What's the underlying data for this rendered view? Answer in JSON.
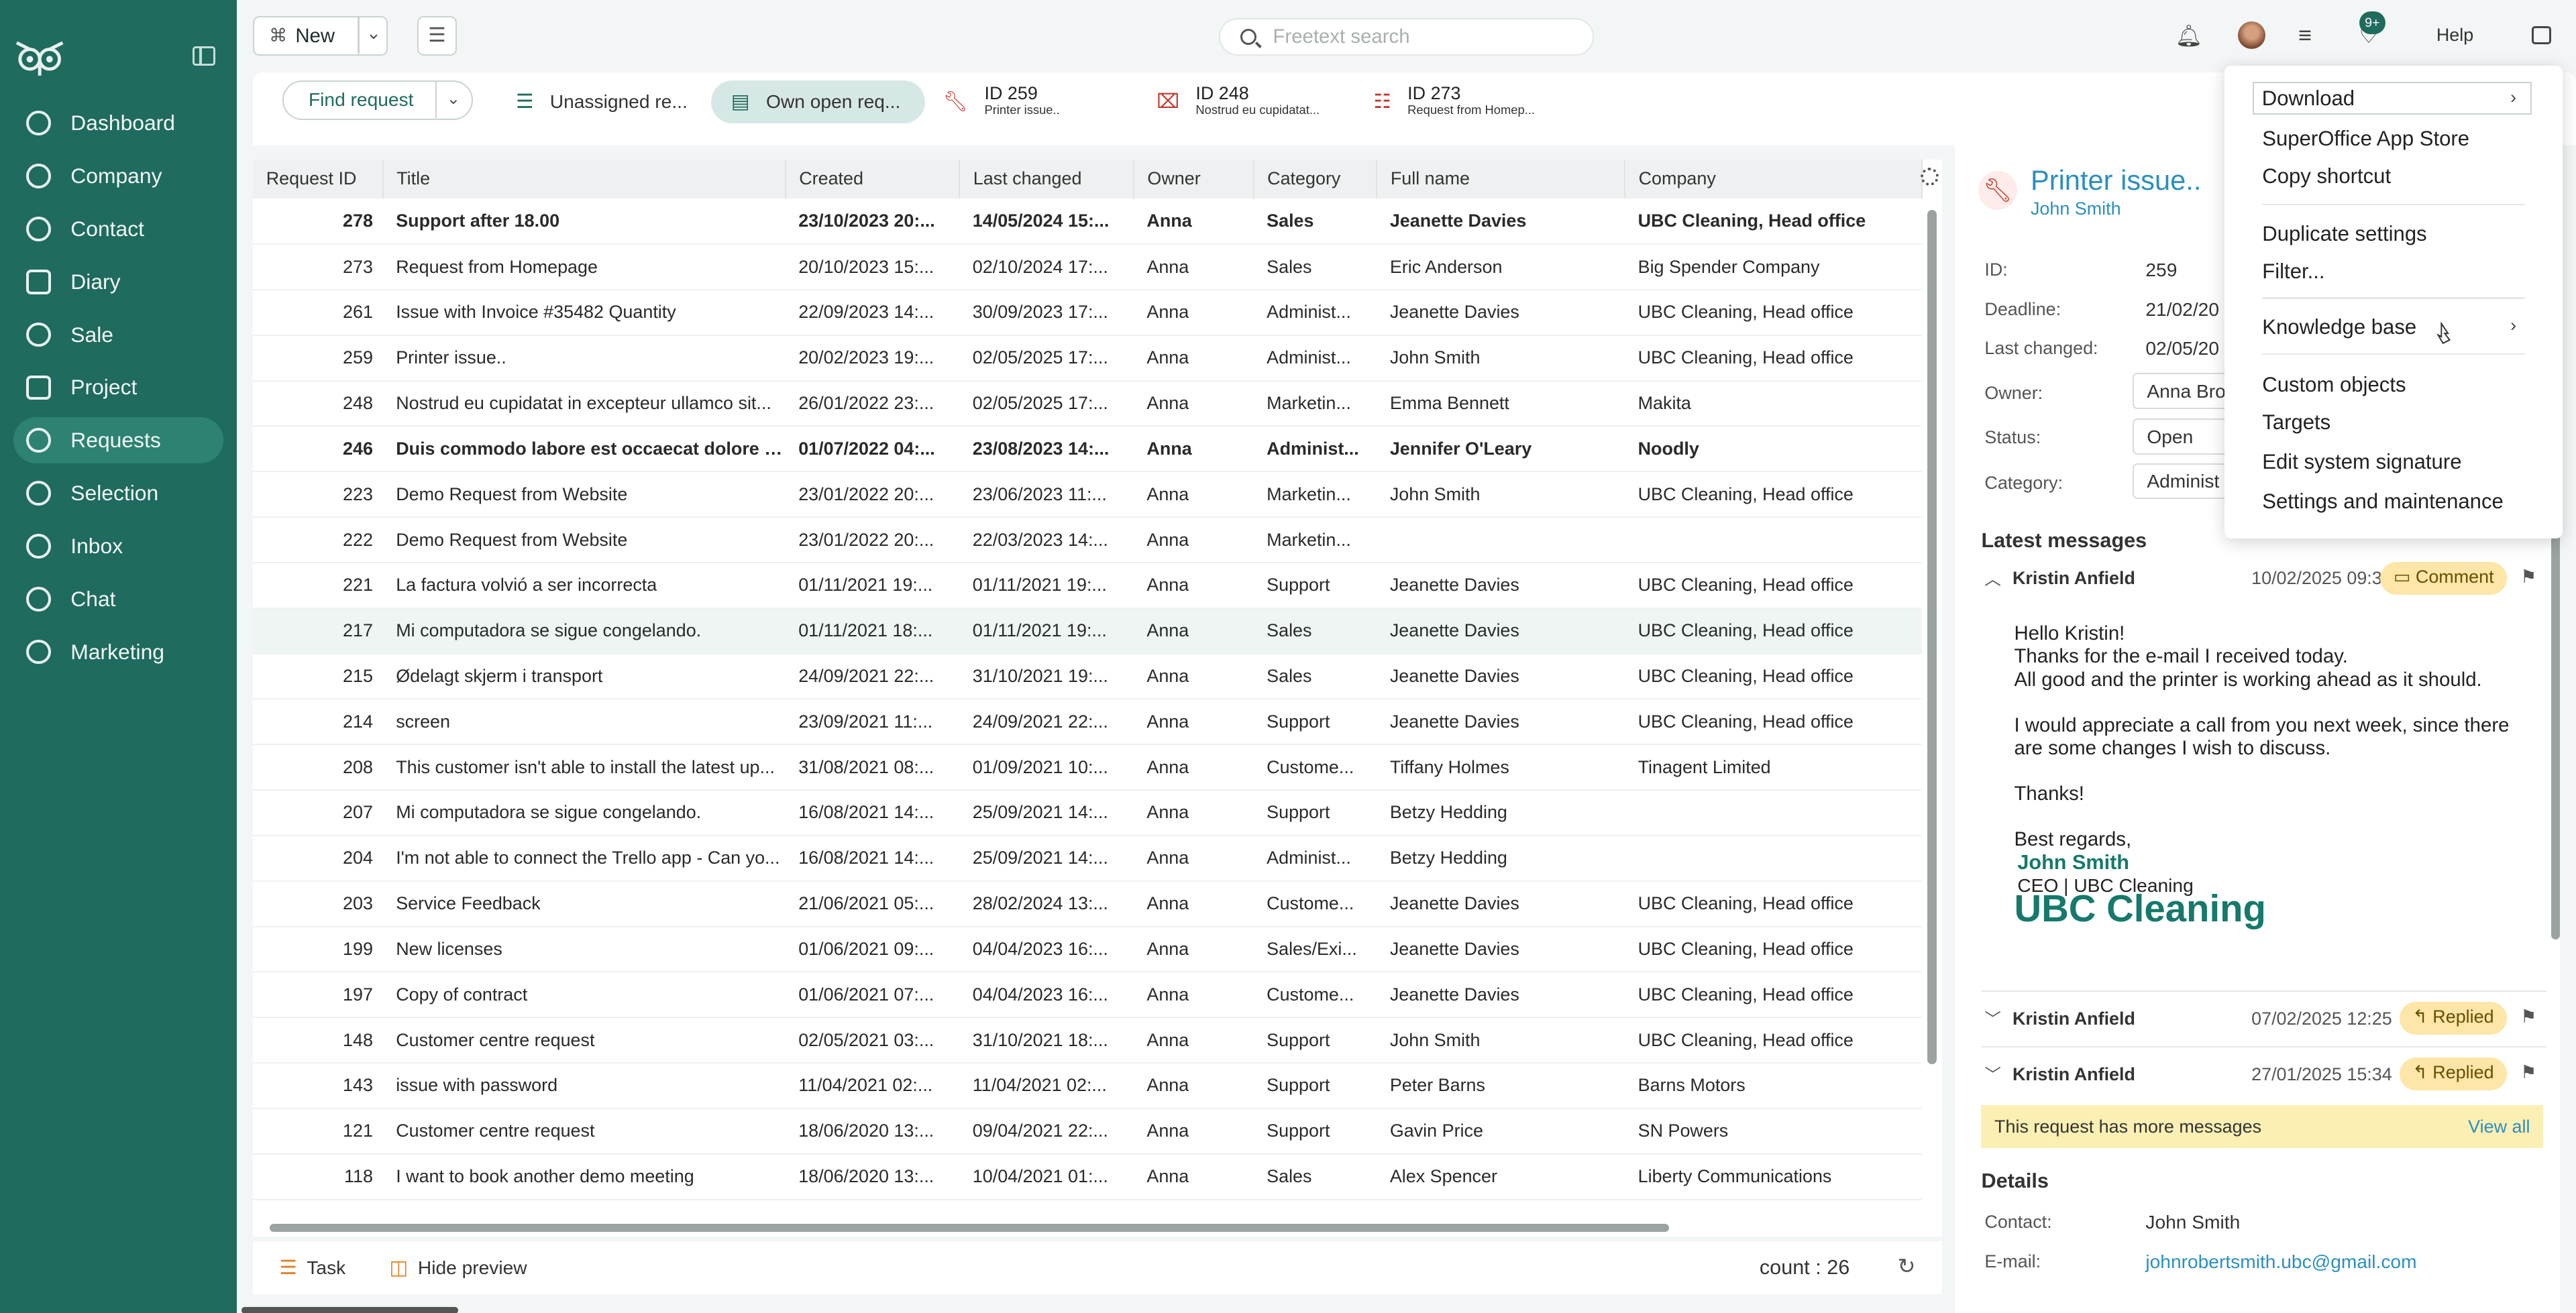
{
  "sidebar": {
    "items": [
      {
        "label": "Dashboard",
        "icon": "dashboard-icon"
      },
      {
        "label": "Company",
        "icon": "building-icon"
      },
      {
        "label": "Contact",
        "icon": "contact-icon"
      },
      {
        "label": "Diary",
        "icon": "calendar-icon"
      },
      {
        "label": "Sale",
        "icon": "dollar-icon"
      },
      {
        "label": "Project",
        "icon": "clipboard-icon"
      },
      {
        "label": "Requests",
        "icon": "ticket-icon",
        "active": true
      },
      {
        "label": "Selection",
        "icon": "target-icon"
      },
      {
        "label": "Inbox",
        "icon": "at-icon"
      },
      {
        "label": "Chat",
        "icon": "chat-icon"
      },
      {
        "label": "Marketing",
        "icon": "megaphone-icon"
      }
    ]
  },
  "topbar": {
    "new_label": "New",
    "search_placeholder": "Freetext search",
    "badge": "9+",
    "help": "Help"
  },
  "tabs": {
    "find_label": "Find request",
    "unassigned": "Unassigned re...",
    "own_open": "Own open req...",
    "open_items": [
      {
        "id": "ID 259",
        "sub": "Printer issue.."
      },
      {
        "id": "ID 248",
        "sub": "Nostrud eu cupidatat..."
      },
      {
        "id": "ID 273",
        "sub": "Request from Homep..."
      }
    ]
  },
  "table": {
    "headers": [
      "Request ID",
      "Title",
      "Created",
      "Last changed",
      "Owner",
      "Category",
      "Full name",
      "Company"
    ],
    "rows": [
      [
        "278",
        "Support after 18.00",
        "23/10/2023 20:...",
        "14/05/2024 15:...",
        "Anna",
        "Sales",
        "Jeanette Davies",
        "UBC Cleaning, Head office"
      ],
      [
        "273",
        "Request from Homepage",
        "20/10/2023 15:...",
        "02/10/2024 17:...",
        "Anna",
        "Sales",
        "Eric Anderson",
        "Big Spender Company"
      ],
      [
        "261",
        "Issue with Invoice #35482 Quantity",
        "22/09/2023 14:...",
        "30/09/2023 17:...",
        "Anna",
        "Administ...",
        "Jeanette Davies",
        "UBC Cleaning, Head office"
      ],
      [
        "259",
        "Printer issue..",
        "20/02/2023 19:...",
        "02/05/2025 17:...",
        "Anna",
        "Administ...",
        "John Smith",
        "UBC Cleaning, Head office"
      ],
      [
        "248",
        "Nostrud eu cupidatat in excepteur ullamco sit...",
        "26/01/2022 23:...",
        "02/05/2025 17:...",
        "Anna",
        "Marketin...",
        "Emma Bennett",
        "Makita"
      ],
      [
        "246",
        "Duis commodo labore est occaecat dolore ut...",
        "01/07/2022 04:...",
        "23/08/2023 14:...",
        "Anna",
        "Administ...",
        "Jennifer O'Leary",
        "Noodly"
      ],
      [
        "223",
        "Demo Request from Website",
        "23/01/2022 20:...",
        "23/06/2023 11:...",
        "Anna",
        "Marketin...",
        "John Smith",
        "UBC Cleaning, Head office"
      ],
      [
        "222",
        "Demo Request from Website",
        "23/01/2022 20:...",
        "22/03/2023 14:...",
        "Anna",
        "Marketin...",
        "",
        ""
      ],
      [
        "221",
        "La factura volvió a ser incorrecta",
        "01/11/2021 19:...",
        "01/11/2021 19:...",
        "Anna",
        "Support",
        "Jeanette Davies",
        "UBC Cleaning, Head office"
      ],
      [
        "217",
        "Mi computadora se sigue congelando.",
        "01/11/2021 18:...",
        "01/11/2021 19:...",
        "Anna",
        "Sales",
        "Jeanette Davies",
        "UBC Cleaning, Head office"
      ],
      [
        "215",
        "Ødelagt skjerm i transport",
        "24/09/2021 22:...",
        "31/10/2021 19:...",
        "Anna",
        "Sales",
        "Jeanette Davies",
        "UBC Cleaning, Head office"
      ],
      [
        "214",
        "screen",
        "23/09/2021 11:...",
        "24/09/2021 22:...",
        "Anna",
        "Support",
        "Jeanette Davies",
        "UBC Cleaning, Head office"
      ],
      [
        "208",
        "This customer isn't able to install the latest up...",
        "31/08/2021 08:...",
        "01/09/2021 10:...",
        "Anna",
        "Custome...",
        "Tiffany Holmes",
        "Tinagent Limited"
      ],
      [
        "207",
        "Mi computadora se sigue congelando.",
        "16/08/2021 14:...",
        "25/09/2021 14:...",
        "Anna",
        "Support",
        "Betzy Hedding",
        ""
      ],
      [
        "204",
        "I'm not able to connect the Trello app - Can yo...",
        "16/08/2021 14:...",
        "25/09/2021 14:...",
        "Anna",
        "Administ...",
        "Betzy Hedding",
        ""
      ],
      [
        "203",
        "Service Feedback",
        "21/06/2021 05:...",
        "28/02/2024 13:...",
        "Anna",
        "Custome...",
        "Jeanette Davies",
        "UBC Cleaning, Head office"
      ],
      [
        "199",
        "New licenses",
        "01/06/2021 09:...",
        "04/04/2023 16:...",
        "Anna",
        "Sales/Exi...",
        "Jeanette Davies",
        "UBC Cleaning, Head office"
      ],
      [
        "197",
        "Copy of contract",
        "01/06/2021 07:...",
        "04/04/2023 16:...",
        "Anna",
        "Custome...",
        "Jeanette Davies",
        "UBC Cleaning, Head office"
      ],
      [
        "148",
        "Customer centre request",
        "02/05/2021 03:...",
        "31/10/2021 18:...",
        "Anna",
        "Support",
        "John Smith",
        "UBC Cleaning, Head office"
      ],
      [
        "143",
        "issue with password",
        "11/04/2021 02:...",
        "11/04/2021 02:...",
        "Anna",
        "Support",
        "Peter Barns",
        "Barns Motors"
      ],
      [
        "121",
        "Customer centre request",
        "18/06/2020 13:...",
        "09/04/2021 22:...",
        "Anna",
        "Support",
        "Gavin Price",
        "SN Powers"
      ],
      [
        "118",
        "I want to book another demo meeting",
        "18/06/2020 13:...",
        "10/04/2021 01:...",
        "Anna",
        "Sales",
        "Alex Spencer",
        "Liberty Communications"
      ]
    ],
    "bold_rows": [
      0,
      5
    ],
    "highlight_row": 9
  },
  "footer": {
    "task": "Task",
    "hide_preview": "Hide preview",
    "count": "count : 26"
  },
  "preview": {
    "title": "Printer issue..",
    "subtitle": "John Smith",
    "fields": {
      "id_label": "ID:",
      "id_value": "259",
      "deadline_label": "Deadline:",
      "deadline_value": "21/02/20",
      "last_changed_label": "Last changed:",
      "last_changed_value": "02/05/20",
      "owner_label": "Owner:",
      "owner_value": "Anna Bro",
      "status_label": "Status:",
      "status_value": "Open",
      "category_label": "Category:",
      "category_value": "Administ"
    },
    "latest_messages": "Latest messages",
    "messages": [
      {
        "name": "Kristin Anfield",
        "date": "10/02/2025 09:32",
        "tag": "Comment"
      },
      {
        "name": "Kristin Anfield",
        "date": "07/02/2025 12:25",
        "tag": "Replied"
      },
      {
        "name": "Kristin Anfield",
        "date": "27/01/2025 15:34",
        "tag": "Replied"
      }
    ],
    "body": {
      "l1": "Hello Kristin!",
      "l2": "Thanks for the e-mail I received today.",
      "l3": "All good and the printer is working ahead as it should.",
      "l4": "I would appreciate a call from you next week, since there are some changes I wish to discuss.",
      "l5": "Thanks!",
      "l6": "Best regards,",
      "sig_name": "John Smith",
      "sig_role": "CEO | UBC Cleaning",
      "sig_logo": "UBC Cleaning"
    },
    "more_text": "This request has more messages",
    "view_all": "View all",
    "details": "Details",
    "contact_label": "Contact:",
    "contact_value": "John Smith",
    "email_label": "E-mail:",
    "email_value": "johnrobertsmith.ubc@gmail.com"
  },
  "menu": {
    "items": [
      "Download",
      "SuperOffice App Store",
      "Copy shortcut",
      "Duplicate settings",
      "Filter...",
      "Knowledge base",
      "Custom objects",
      "Targets",
      "Edit system signature",
      "Settings and maintenance"
    ]
  },
  "colors": {
    "sidebar": "#1f6b5e",
    "accent": "#2b8fc1",
    "comment_pill": "#fde6a8"
  }
}
